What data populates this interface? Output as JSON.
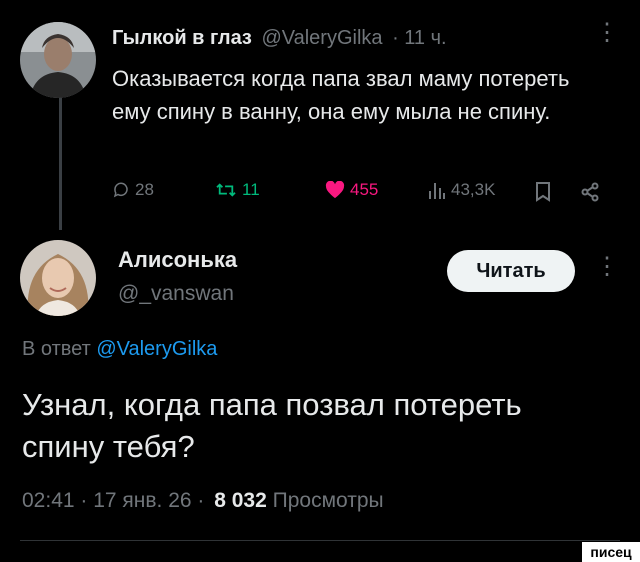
{
  "tweet1": {
    "author_name": "Гылкой в глаз",
    "handle": "@ValeryGilka",
    "time": "· 11 ч.",
    "text": "Оказывается когда папа звал маму потереть ему спину в ванну, она ему мыла не спину.",
    "replies": "28",
    "retweets": "11",
    "likes": "455",
    "views": "43,3K"
  },
  "tweet2": {
    "author_name": "Алисонька",
    "handle": "@_vanswan",
    "follow_label": "Читать",
    "reply_prefix": "В ответ",
    "reply_to": "@ValeryGilka",
    "text": "Узнал, когда папа позвал потереть спину тебя?",
    "timestamp": "02:41 · 17 янв. 26 ·",
    "view_count": "8 032",
    "views_label": "Просмотры"
  },
  "watermark": "писец",
  "colors": {
    "background": "#000000",
    "text": "#e7e9ea",
    "muted": "#71767b",
    "link": "#1d9bf0",
    "retweet": "#00ba7c",
    "like": "#f91880"
  }
}
